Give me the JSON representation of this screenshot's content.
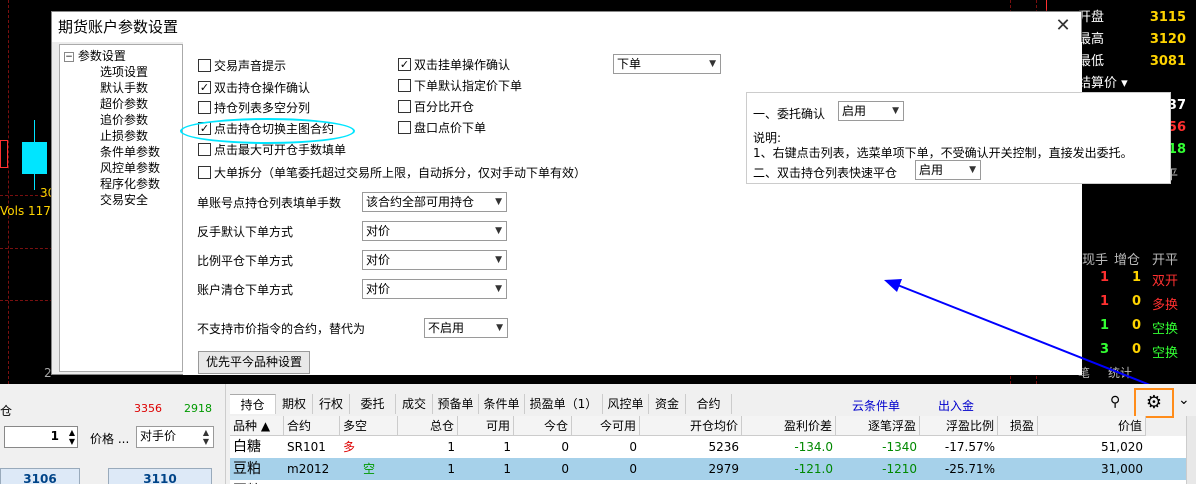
{
  "chart_bg": {
    "left_label_30": "30",
    "vols_label": "Vols 117.0",
    "bottom_label_2": "2"
  },
  "right_panel": {
    "rows": [
      {
        "label": "开盘",
        "value": "3115",
        "color": "#ffd400"
      },
      {
        "label": "最高",
        "value": "3120",
        "color": "#ffd400"
      },
      {
        "label": "最低",
        "value": "3081",
        "color": "#ffd400"
      },
      {
        "label": "结算价 ▾",
        "value": "",
        "color": "#ffffff"
      },
      {
        "label": "昨结 ▾",
        "value": "3137",
        "color": "#ffffff"
      },
      {
        "label": "涨停",
        "value": "3356",
        "color": "#ff3030"
      },
      {
        "label": "跌停",
        "value": "2918",
        "color": "#33ff33"
      }
    ],
    "header1": {
      "a": "大单",
      "b": "增仓",
      "c": "开平"
    },
    "header2": {
      "a": "现手",
      "b": "增仓",
      "c": "开平"
    },
    "trades": [
      {
        "qty": "1",
        "inc": "1",
        "type": "双开",
        "color": "#ff3030"
      },
      {
        "qty": "1",
        "inc": "0",
        "type": "多换",
        "color": "#ff3030"
      },
      {
        "qty": "1",
        "inc": "0",
        "type": "空换",
        "color": "#33ff33"
      },
      {
        "qty": "3",
        "inc": "0",
        "type": "空换",
        "color": "#33ff33"
      }
    ],
    "footer_a": "笔",
    "footer_b": "统计"
  },
  "dialog": {
    "title": "期货账户参数设置",
    "close": "✕",
    "tree": {
      "root": "参数设置",
      "items": [
        "选项设置",
        "默认手数",
        "超价参数",
        "追价参数",
        "止损参数",
        "条件单参数",
        "风控单参数",
        "程序化参数",
        "交易安全"
      ]
    },
    "checkboxes_col1": [
      {
        "label": "交易声音提示",
        "checked": ""
      },
      {
        "label": "双击持仓操作确认",
        "checked": "✓"
      },
      {
        "label": "持仓列表多空分列",
        "checked": ""
      },
      {
        "label": "点击持仓切换主图合约",
        "checked": "✓"
      },
      {
        "label": "点击最大可开仓手数填单",
        "checked": ""
      },
      {
        "label": "大单拆分（单笔委托超过交易所上限，自动拆分，仅对手动下单有效）",
        "checked": ""
      }
    ],
    "checkboxes_col2": [
      {
        "label": "双击挂单操作确认",
        "checked": "✓"
      },
      {
        "label": "下单默认指定价下单",
        "checked": ""
      },
      {
        "label": "百分比开仓",
        "checked": ""
      },
      {
        "label": "盘口点价下单",
        "checked": ""
      }
    ],
    "order_select": "下单",
    "settings": [
      {
        "label": "单账号点持仓列表填单手数",
        "value": "该合约全部可用持仓"
      },
      {
        "label": "反手默认下单方式",
        "value": "对价"
      },
      {
        "label": "比例平仓下单方式",
        "value": "对价"
      },
      {
        "label": "账户清仓下单方式",
        "value": "对价"
      }
    ],
    "market_label": "不支持市价指令的合约，替代为",
    "market_value": "不启用",
    "priority_button": "优先平今品种设置",
    "confirm_label": "一、委托确认",
    "confirm_value": "启用",
    "note_title": "说明:",
    "note_text": "1、右键点击列表，选菜单项下单，不受确认开关控制，直接发出委托。",
    "quick_close_label": "二、双击持仓列表快速平仓",
    "quick_close_value": "启用"
  },
  "left_panel": {
    "label_cang": "仓",
    "limit_up": "3356",
    "limit_down": "2918",
    "qty": "1",
    "price_label": "价格 ...",
    "price_type": "对手价",
    "buy_price": "3106",
    "sell_price": "3110"
  },
  "tabs": [
    "持仓",
    "期权",
    "行权",
    "委托",
    "成交",
    "预备单",
    "条件单",
    "损盈单（1）",
    "风控单",
    "资金",
    "合约"
  ],
  "links": {
    "cloud": "云条件单",
    "transfer": "出入金"
  },
  "table": {
    "headers": [
      "品种 ▲",
      "合约",
      "多空",
      "总仓",
      "可用",
      "今仓",
      "今可用",
      "开仓均价",
      "盈利价差",
      "逐笔浮盈",
      "浮盈比例",
      "损盈",
      "价值"
    ],
    "rows": [
      {
        "cells": [
          "白糖",
          "SR101",
          "多",
          "1",
          "1",
          "0",
          "0",
          "5236",
          "-134.0",
          "-1340",
          "-17.57%",
          "",
          "51,020"
        ],
        "dir_color": "#dd0000"
      },
      {
        "cells": [
          "豆粕",
          "m2012",
          "空",
          "1",
          "1",
          "0",
          "0",
          "2979",
          "-121.0",
          "-1210",
          "-25.71%",
          "",
          "31,000"
        ],
        "dir_color": "#009900"
      }
    ],
    "partial_row_first": "豆粕",
    "partial_row_dir": "多"
  },
  "colors": {
    "accent_blue": "#0000cc",
    "annotation_cyan": "#00e5ff",
    "highlight_orange": "#ff8c1a",
    "loss_green": "#008800",
    "selected_row": "#a6d1ea"
  }
}
